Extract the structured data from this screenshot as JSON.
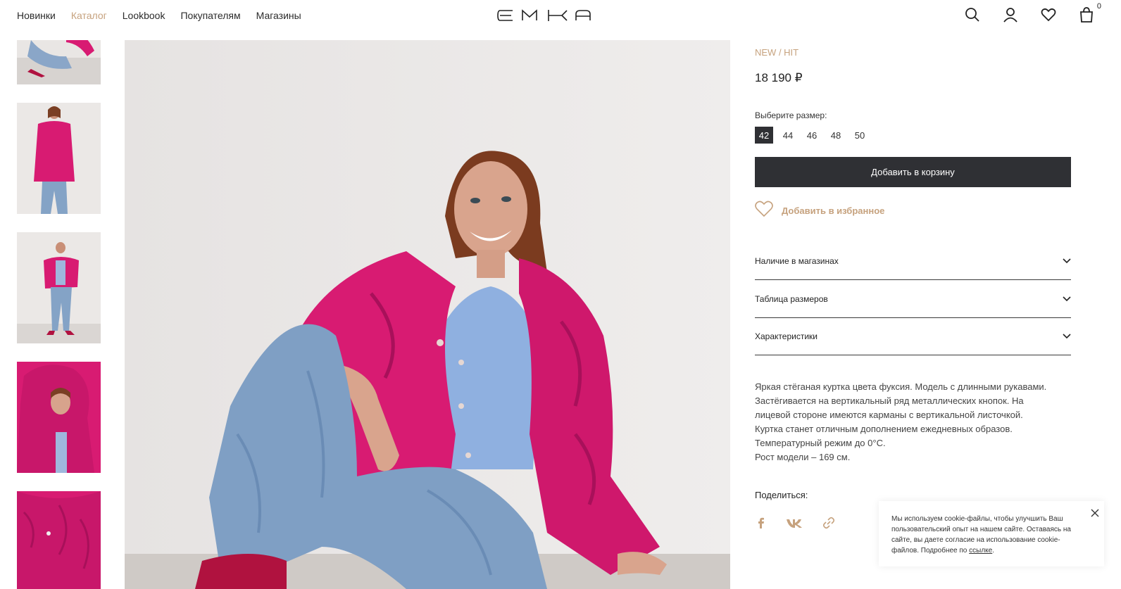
{
  "header": {
    "nav": [
      {
        "label": "Новинки"
      },
      {
        "label": "Каталог"
      },
      {
        "label": "Lookbook"
      },
      {
        "label": "Покупателям"
      },
      {
        "label": "Магазины"
      }
    ],
    "logo_text": "EMKA",
    "cart_count": "0",
    "icons": [
      "search-icon",
      "account-icon",
      "wishlist-icon",
      "cart-icon"
    ]
  },
  "product": {
    "tag": "NEW / HIT",
    "price": "18 190 ₽",
    "size_label": "Выберите размер:",
    "sizes": [
      "42",
      "44",
      "46",
      "48",
      "50"
    ],
    "selected_size": "42",
    "add_to_cart": "Добавить в корзину",
    "add_to_favorites": "Добавить в избранное",
    "accordion": [
      {
        "label": "Наличие в магазинах"
      },
      {
        "label": "Таблица размеров"
      },
      {
        "label": "Характеристики"
      }
    ],
    "description": [
      "Яркая стёганая куртка цвета фуксия. Модель с длинными рукавами.",
      "Застёгивается на вертикальный ряд металлических кнопок. На",
      "лицевой стороне имеются карманы с вертикальной листочкой.",
      "Куртка станет отличным дополнением ежедневных образов.",
      "Температурный режим до 0°С.",
      "Рост модели – 169 см."
    ],
    "share_label": "Поделиться:",
    "share_icons": [
      "facebook-icon",
      "vk-icon",
      "link-icon"
    ]
  },
  "cookie": {
    "text": "Мы используем cookie-файлы, чтобы улучшить Ваш пользовательский опыт на нашем сайте. Оставаясь на сайте, вы даете согласие на использование cookie-файлов. Подробнее по ",
    "link": "ссылке"
  },
  "colors": {
    "accent": "#c6a27e",
    "dark": "#2f3034",
    "jacket": "#d81b72",
    "jeans": "#7f9fc4"
  }
}
